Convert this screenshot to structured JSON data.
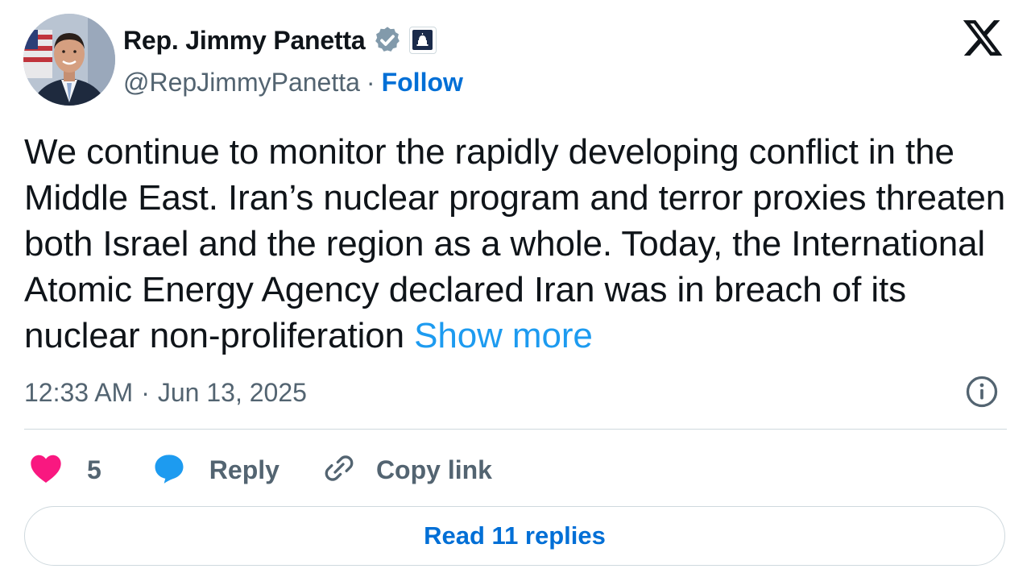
{
  "author": {
    "display_name": "Rep. Jimmy Panetta",
    "handle": "@RepJimmyPanetta",
    "separator": "·",
    "follow_label": "Follow",
    "verified_color": "#829aab"
  },
  "tweet": {
    "text": "We continue to monitor the rapidly developing conflict in the Middle East. Iran’s nuclear program and terror proxies threaten both Israel and the region as a whole. Today, the International Atomic Energy Agency declared Iran was in breach of its nuclear non-proliferation",
    "show_more_label": "Show more",
    "time": "12:33 AM",
    "meta_separator": "·",
    "date": "Jun 13, 2025"
  },
  "actions": {
    "like_count": "5",
    "reply_label": "Reply",
    "copy_link_label": "Copy link"
  },
  "footer": {
    "read_replies_label": "Read 11 replies"
  },
  "colors": {
    "link": "#006fd6",
    "show_more": "#1d9bf0",
    "heart": "#f91880",
    "reply_bubble": "#1d9bf0",
    "secondary_text": "#536471"
  },
  "icons": [
    "verified-badge-icon",
    "government-affiliation-icon",
    "x-logo-icon",
    "info-icon",
    "heart-icon",
    "reply-icon",
    "link-icon"
  ]
}
